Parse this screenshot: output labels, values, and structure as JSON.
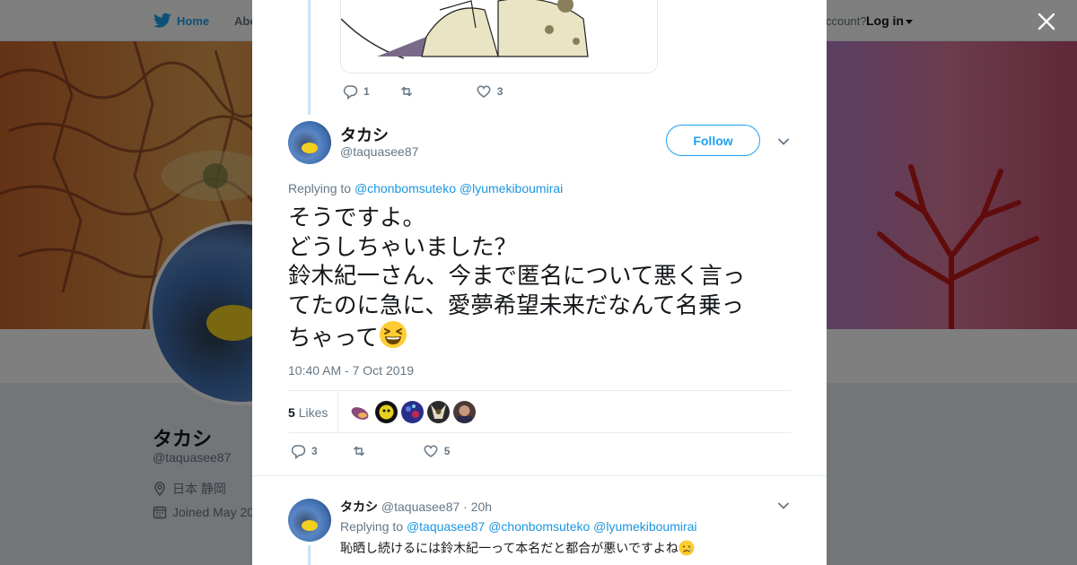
{
  "nav": {
    "home_label": "Home",
    "about_label": "Abo",
    "have_account_text": "ccount?",
    "login_label": "Log in"
  },
  "profile": {
    "name": "タカシ",
    "handle": "@taquasee87",
    "location": "日本 静岡",
    "joined": "Joined May 20"
  },
  "modal": {
    "prev_tweet": {
      "reply_count": "1",
      "retweet_count": "",
      "like_count": "3"
    },
    "tweet": {
      "author_name": "タカシ",
      "author_handle": "@taquasee87",
      "follow_label": "Follow",
      "replying_prefix": "Replying to",
      "replying_to": [
        "@chonbomsuteko",
        "@lyumekiboumirai"
      ],
      "text_lines": [
        "そうですよ。",
        "どうしちゃいました？",
        "鈴木紀一さん、今まで匿名について悪く言っ",
        "てたのに急に、愛夢希望未来だなんて名乗っ",
        "ちゃって"
      ],
      "text_emoji": "grinning-squinting-face",
      "timestamp": "10:40 AM - 7 Oct 2019",
      "likes_count": "5",
      "likes_label": "Likes",
      "reply_count": "3",
      "retweet_count": "",
      "like_count": "5"
    },
    "reply": {
      "author_name": "タカシ",
      "author_handle": "@taquasee87",
      "dot": "·",
      "time": "20h",
      "replying_prefix": "Replying to",
      "replying_to": [
        "@taquasee87",
        "@chonbomsuteko",
        "@lyumekiboumirai"
      ],
      "text": "恥晒し続けるには鈴木紀一って本名だと都合が悪いですよね",
      "text_emoji": "crying-face"
    }
  },
  "colors": {
    "accent": "#1da1f2",
    "link": "#1b95e0",
    "secondary_text": "#657786",
    "like_heart": "#657786"
  }
}
